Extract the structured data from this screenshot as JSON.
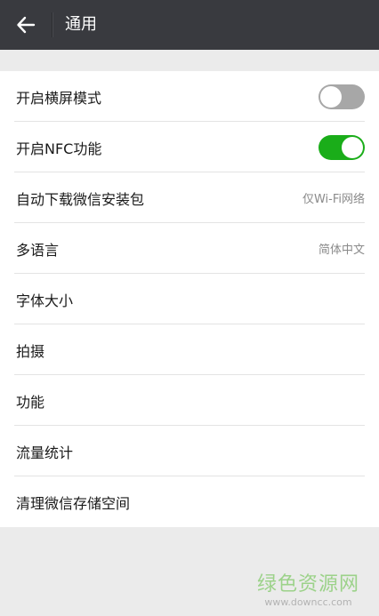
{
  "header": {
    "title": "通用",
    "back_icon": "arrow-left-icon"
  },
  "settings": [
    {
      "label": "开启横屏模式",
      "type": "switch",
      "on": false
    },
    {
      "label": "开启NFC功能",
      "type": "switch",
      "on": true
    },
    {
      "label": "自动下载微信安装包",
      "type": "value",
      "value": "仅Wi-Fi网络"
    },
    {
      "label": "多语言",
      "type": "value",
      "value": "简体中文"
    },
    {
      "label": "字体大小",
      "type": "link"
    },
    {
      "label": "拍摄",
      "type": "link"
    },
    {
      "label": "功能",
      "type": "link"
    },
    {
      "label": "流量统计",
      "type": "link"
    },
    {
      "label": "清理微信存储空间",
      "type": "link"
    }
  ],
  "watermark": {
    "main": "绿色资源网",
    "url": "www.downcc.com"
  },
  "colors": {
    "header_bg": "#393a3f",
    "switch_on": "#1aad19",
    "switch_off": "#a7a7a7",
    "page_bg": "#ebebeb"
  }
}
